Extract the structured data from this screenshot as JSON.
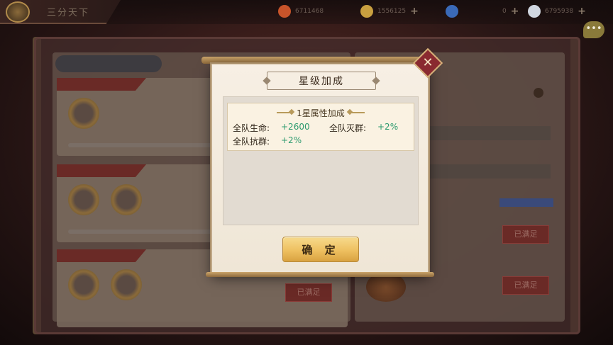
{
  "background": {
    "title": "三分天下",
    "resources": [
      {
        "icon": "fire-icon",
        "value": "6711468",
        "color": "#c8542a"
      },
      {
        "icon": "gold-ingot-icon",
        "value": "1556125",
        "color": "#c9a040"
      },
      {
        "icon": "jade-icon",
        "value": "0",
        "color": "#3a6ab8"
      },
      {
        "icon": "silver-coin-icon",
        "value": "6795938",
        "color": "#d0d6e0"
      }
    ],
    "chat_icon": "chat-bubble-icon",
    "buttons": {
      "claimed_1": "已满足",
      "claimed_2": "已满足",
      "claimed_3": "已满足"
    }
  },
  "dialog": {
    "title": "星级加成",
    "bonus_header": "1星属性加成",
    "stats": [
      {
        "label": "全队生命:",
        "value": "+2600"
      },
      {
        "label": "全队灭群:",
        "value": "+2%"
      },
      {
        "label": "全队抗群:",
        "value": "+2%"
      }
    ],
    "confirm_label": "确 定",
    "close_icon": "close-icon"
  }
}
